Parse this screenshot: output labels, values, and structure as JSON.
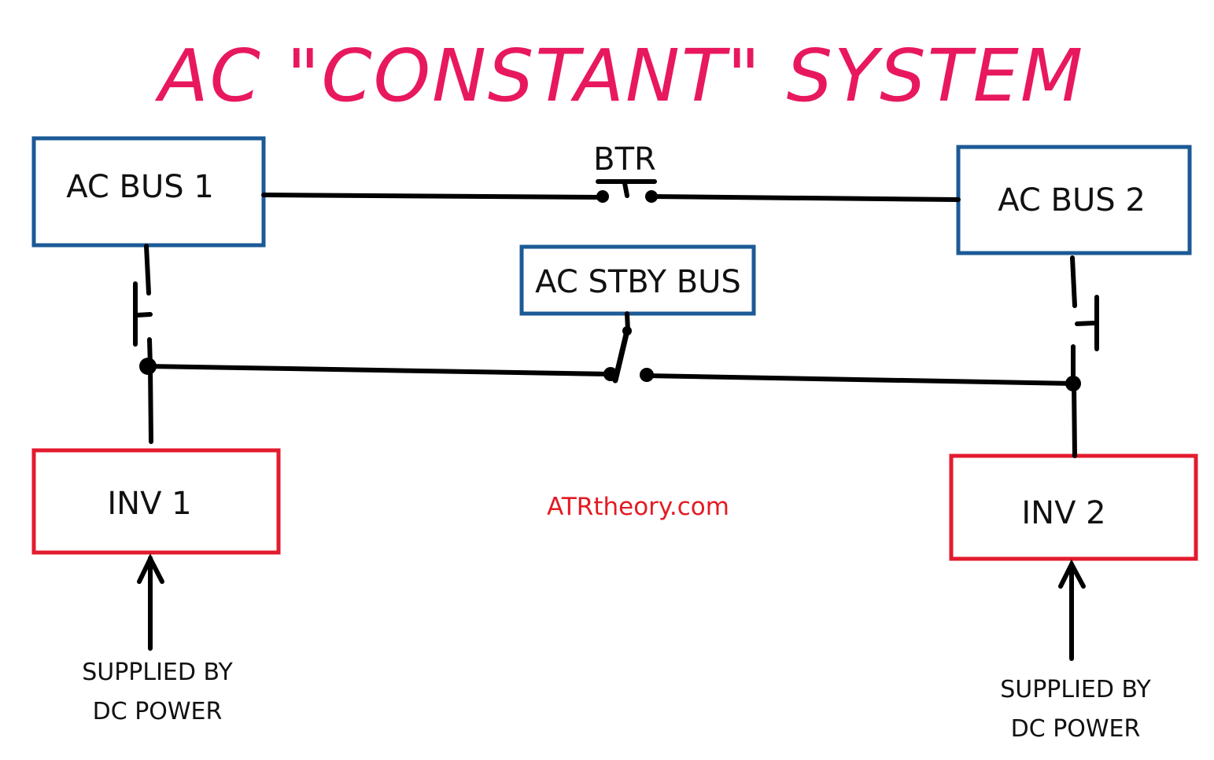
{
  "title": {
    "text": "AC \"CONSTANT\" SYSTEM",
    "color": "#E8185F"
  },
  "colors": {
    "bus_border": "#1B5A96",
    "inverter_border": "#E31B2E",
    "wire": "#000000",
    "watermark": "#E31B23"
  },
  "buses": {
    "ac_bus_1": {
      "label": "AC BUS 1"
    },
    "ac_bus_2": {
      "label": "AC BUS 2"
    },
    "ac_stby_bus": {
      "label": "AC STBY BUS"
    }
  },
  "inverters": {
    "inv_1": {
      "label": "INV 1",
      "supply_line_1": "SUPPLIED BY",
      "supply_line_2": "DC POWER"
    },
    "inv_2": {
      "label": "INV 2",
      "supply_line_1": "SUPPLIED BY",
      "supply_line_2": "DC POWER"
    }
  },
  "switches": {
    "btr": {
      "label": "BTR",
      "state": "open"
    },
    "inv1_to_bus1": {
      "state": "open"
    },
    "inv2_to_bus2": {
      "state": "open"
    },
    "stby_transfer": {
      "state": "connected to INV 1 side"
    }
  },
  "watermark": {
    "text": "ATRtheory.com"
  }
}
